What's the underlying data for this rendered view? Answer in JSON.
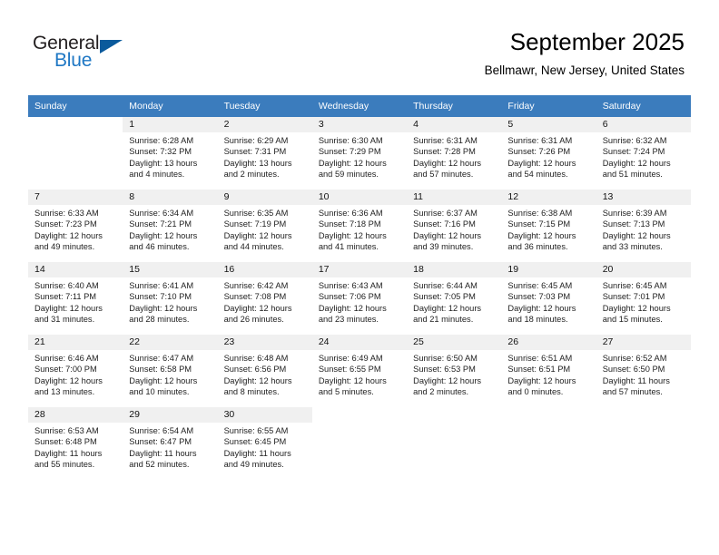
{
  "logo": {
    "word_one": "General",
    "word_two": "Blue",
    "triangle_color": "#0a5a9c",
    "blue_color": "#1e77c4"
  },
  "header": {
    "title": "September 2025",
    "subtitle": "Bellmawr, New Jersey, United States",
    "header_bg": "#3b7cbd",
    "daynum_bg": "#f0f0f0"
  },
  "weekday_headers": [
    "Sunday",
    "Monday",
    "Tuesday",
    "Wednesday",
    "Thursday",
    "Friday",
    "Saturday"
  ],
  "labels": {
    "sunrise": "Sunrise:",
    "sunset": "Sunset:",
    "daylight": "Daylight:"
  },
  "weeks": [
    [
      {
        "day": "",
        "sunrise": "",
        "sunset": "",
        "daylight_a": "",
        "daylight_b": ""
      },
      {
        "day": "1",
        "sunrise": "Sunrise: 6:28 AM",
        "sunset": "Sunset: 7:32 PM",
        "daylight_a": "Daylight: 13 hours",
        "daylight_b": "and 4 minutes."
      },
      {
        "day": "2",
        "sunrise": "Sunrise: 6:29 AM",
        "sunset": "Sunset: 7:31 PM",
        "daylight_a": "Daylight: 13 hours",
        "daylight_b": "and 2 minutes."
      },
      {
        "day": "3",
        "sunrise": "Sunrise: 6:30 AM",
        "sunset": "Sunset: 7:29 PM",
        "daylight_a": "Daylight: 12 hours",
        "daylight_b": "and 59 minutes."
      },
      {
        "day": "4",
        "sunrise": "Sunrise: 6:31 AM",
        "sunset": "Sunset: 7:28 PM",
        "daylight_a": "Daylight: 12 hours",
        "daylight_b": "and 57 minutes."
      },
      {
        "day": "5",
        "sunrise": "Sunrise: 6:31 AM",
        "sunset": "Sunset: 7:26 PM",
        "daylight_a": "Daylight: 12 hours",
        "daylight_b": "and 54 minutes."
      },
      {
        "day": "6",
        "sunrise": "Sunrise: 6:32 AM",
        "sunset": "Sunset: 7:24 PM",
        "daylight_a": "Daylight: 12 hours",
        "daylight_b": "and 51 minutes."
      }
    ],
    [
      {
        "day": "7",
        "sunrise": "Sunrise: 6:33 AM",
        "sunset": "Sunset: 7:23 PM",
        "daylight_a": "Daylight: 12 hours",
        "daylight_b": "and 49 minutes."
      },
      {
        "day": "8",
        "sunrise": "Sunrise: 6:34 AM",
        "sunset": "Sunset: 7:21 PM",
        "daylight_a": "Daylight: 12 hours",
        "daylight_b": "and 46 minutes."
      },
      {
        "day": "9",
        "sunrise": "Sunrise: 6:35 AM",
        "sunset": "Sunset: 7:19 PM",
        "daylight_a": "Daylight: 12 hours",
        "daylight_b": "and 44 minutes."
      },
      {
        "day": "10",
        "sunrise": "Sunrise: 6:36 AM",
        "sunset": "Sunset: 7:18 PM",
        "daylight_a": "Daylight: 12 hours",
        "daylight_b": "and 41 minutes."
      },
      {
        "day": "11",
        "sunrise": "Sunrise: 6:37 AM",
        "sunset": "Sunset: 7:16 PM",
        "daylight_a": "Daylight: 12 hours",
        "daylight_b": "and 39 minutes."
      },
      {
        "day": "12",
        "sunrise": "Sunrise: 6:38 AM",
        "sunset": "Sunset: 7:15 PM",
        "daylight_a": "Daylight: 12 hours",
        "daylight_b": "and 36 minutes."
      },
      {
        "day": "13",
        "sunrise": "Sunrise: 6:39 AM",
        "sunset": "Sunset: 7:13 PM",
        "daylight_a": "Daylight: 12 hours",
        "daylight_b": "and 33 minutes."
      }
    ],
    [
      {
        "day": "14",
        "sunrise": "Sunrise: 6:40 AM",
        "sunset": "Sunset: 7:11 PM",
        "daylight_a": "Daylight: 12 hours",
        "daylight_b": "and 31 minutes."
      },
      {
        "day": "15",
        "sunrise": "Sunrise: 6:41 AM",
        "sunset": "Sunset: 7:10 PM",
        "daylight_a": "Daylight: 12 hours",
        "daylight_b": "and 28 minutes."
      },
      {
        "day": "16",
        "sunrise": "Sunrise: 6:42 AM",
        "sunset": "Sunset: 7:08 PM",
        "daylight_a": "Daylight: 12 hours",
        "daylight_b": "and 26 minutes."
      },
      {
        "day": "17",
        "sunrise": "Sunrise: 6:43 AM",
        "sunset": "Sunset: 7:06 PM",
        "daylight_a": "Daylight: 12 hours",
        "daylight_b": "and 23 minutes."
      },
      {
        "day": "18",
        "sunrise": "Sunrise: 6:44 AM",
        "sunset": "Sunset: 7:05 PM",
        "daylight_a": "Daylight: 12 hours",
        "daylight_b": "and 21 minutes."
      },
      {
        "day": "19",
        "sunrise": "Sunrise: 6:45 AM",
        "sunset": "Sunset: 7:03 PM",
        "daylight_a": "Daylight: 12 hours",
        "daylight_b": "and 18 minutes."
      },
      {
        "day": "20",
        "sunrise": "Sunrise: 6:45 AM",
        "sunset": "Sunset: 7:01 PM",
        "daylight_a": "Daylight: 12 hours",
        "daylight_b": "and 15 minutes."
      }
    ],
    [
      {
        "day": "21",
        "sunrise": "Sunrise: 6:46 AM",
        "sunset": "Sunset: 7:00 PM",
        "daylight_a": "Daylight: 12 hours",
        "daylight_b": "and 13 minutes."
      },
      {
        "day": "22",
        "sunrise": "Sunrise: 6:47 AM",
        "sunset": "Sunset: 6:58 PM",
        "daylight_a": "Daylight: 12 hours",
        "daylight_b": "and 10 minutes."
      },
      {
        "day": "23",
        "sunrise": "Sunrise: 6:48 AM",
        "sunset": "Sunset: 6:56 PM",
        "daylight_a": "Daylight: 12 hours",
        "daylight_b": "and 8 minutes."
      },
      {
        "day": "24",
        "sunrise": "Sunrise: 6:49 AM",
        "sunset": "Sunset: 6:55 PM",
        "daylight_a": "Daylight: 12 hours",
        "daylight_b": "and 5 minutes."
      },
      {
        "day": "25",
        "sunrise": "Sunrise: 6:50 AM",
        "sunset": "Sunset: 6:53 PM",
        "daylight_a": "Daylight: 12 hours",
        "daylight_b": "and 2 minutes."
      },
      {
        "day": "26",
        "sunrise": "Sunrise: 6:51 AM",
        "sunset": "Sunset: 6:51 PM",
        "daylight_a": "Daylight: 12 hours",
        "daylight_b": "and 0 minutes."
      },
      {
        "day": "27",
        "sunrise": "Sunrise: 6:52 AM",
        "sunset": "Sunset: 6:50 PM",
        "daylight_a": "Daylight: 11 hours",
        "daylight_b": "and 57 minutes."
      }
    ],
    [
      {
        "day": "28",
        "sunrise": "Sunrise: 6:53 AM",
        "sunset": "Sunset: 6:48 PM",
        "daylight_a": "Daylight: 11 hours",
        "daylight_b": "and 55 minutes."
      },
      {
        "day": "29",
        "sunrise": "Sunrise: 6:54 AM",
        "sunset": "Sunset: 6:47 PM",
        "daylight_a": "Daylight: 11 hours",
        "daylight_b": "and 52 minutes."
      },
      {
        "day": "30",
        "sunrise": "Sunrise: 6:55 AM",
        "sunset": "Sunset: 6:45 PM",
        "daylight_a": "Daylight: 11 hours",
        "daylight_b": "and 49 minutes."
      },
      {
        "day": "",
        "sunrise": "",
        "sunset": "",
        "daylight_a": "",
        "daylight_b": ""
      },
      {
        "day": "",
        "sunrise": "",
        "sunset": "",
        "daylight_a": "",
        "daylight_b": ""
      },
      {
        "day": "",
        "sunrise": "",
        "sunset": "",
        "daylight_a": "",
        "daylight_b": ""
      },
      {
        "day": "",
        "sunrise": "",
        "sunset": "",
        "daylight_a": "",
        "daylight_b": ""
      }
    ]
  ]
}
